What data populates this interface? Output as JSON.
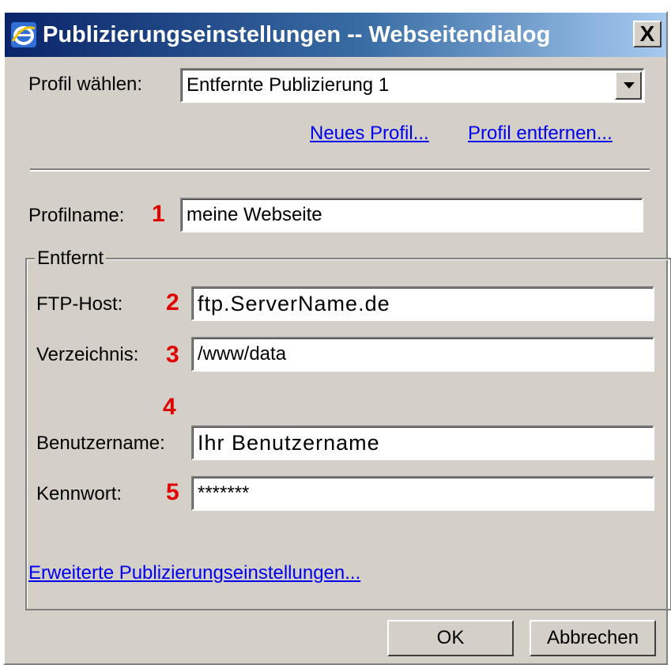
{
  "window": {
    "title": "Publizierungseinstellungen -- Webseitendialog",
    "close_label": "X"
  },
  "profile_select": {
    "label": "Profil wählen:",
    "value": "Entfernte Publizierung 1"
  },
  "links": {
    "new_profile": "Neues Profil...",
    "remove_profile": "Profil entfernen...",
    "advanced": "Erweiterte Publizierungseinstellungen..."
  },
  "profile_name": {
    "label": "Profilname:",
    "marker": "1",
    "value": "meine Webseite"
  },
  "remote_group": {
    "legend": "Entfernt",
    "ftp_host": {
      "label": "FTP-Host:",
      "marker": "2",
      "value": "ftp.ServerName.de"
    },
    "directory": {
      "label": "Verzeichnis:",
      "marker": "3",
      "value": "/www/data"
    },
    "username": {
      "label": "Benutzername:",
      "marker": "4",
      "value": "Ihr Benutzername"
    },
    "password": {
      "label": "Kennwort:",
      "marker": "5",
      "value": "*******"
    }
  },
  "buttons": {
    "ok": "OK",
    "cancel": "Abbrechen"
  },
  "colors": {
    "dialog_bg": "#d4d0c8",
    "marker_red": "#e00000",
    "link_blue": "#0000ee",
    "titlebar_start": "#0a246a",
    "titlebar_end": "#a6caf0"
  }
}
